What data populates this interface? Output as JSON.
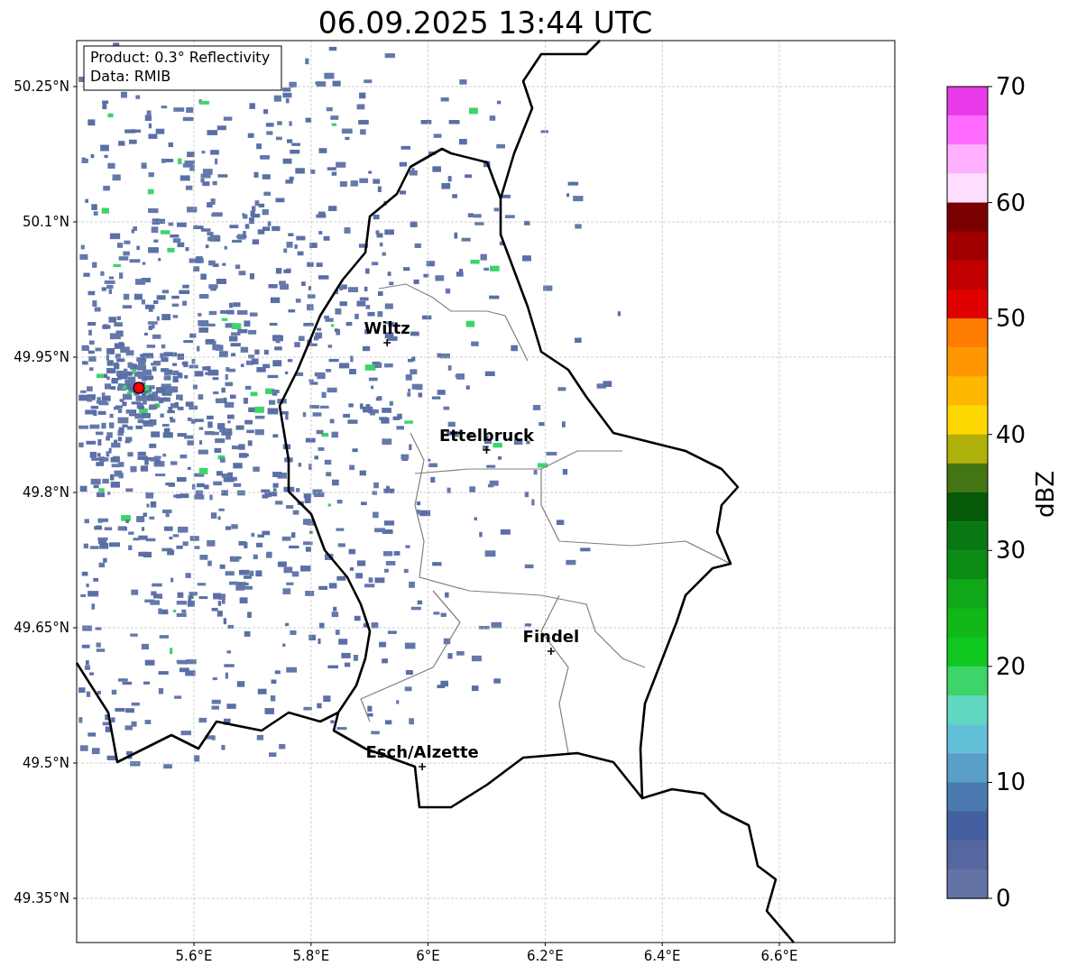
{
  "title": "06.09.2025 13:44 UTC",
  "info_box": {
    "lines": [
      "Product: 0.3° Reflectivity",
      "Data: RMIB"
    ]
  },
  "map": {
    "yticks": [
      "50.25°N",
      "50.1°N",
      "49.95°N",
      "49.8°N",
      "49.65°N",
      "49.5°N",
      "49.35°N"
    ],
    "xticks": [
      "5.6°E",
      "5.8°E",
      "6°E",
      "6.2°E",
      "6.4°E",
      "6.6°E"
    ],
    "cities": [
      {
        "name": "Wiltz"
      },
      {
        "name": "Ettelbruck"
      },
      {
        "name": "Findel"
      },
      {
        "name": "Esch/Alzette"
      }
    ]
  },
  "colorbar": {
    "label": "dBZ",
    "ticks": [
      "70",
      "60",
      "50",
      "40",
      "30",
      "20",
      "10",
      "0"
    ],
    "segments": [
      {
        "color": "#e83ae8"
      },
      {
        "color": "#ff6cff"
      },
      {
        "color": "#ffb0ff"
      },
      {
        "color": "#ffdfff"
      },
      {
        "color": "#7a0000"
      },
      {
        "color": "#a00000"
      },
      {
        "color": "#c00000"
      },
      {
        "color": "#e00000"
      },
      {
        "color": "#ff7d00"
      },
      {
        "color": "#ff9800"
      },
      {
        "color": "#ffb800"
      },
      {
        "color": "#ffd700"
      },
      {
        "color": "#b0b00a"
      },
      {
        "color": "#437514"
      },
      {
        "color": "#055a0a"
      },
      {
        "color": "#0a7812"
      },
      {
        "color": "#0b8a14"
      },
      {
        "color": "#10a818"
      },
      {
        "color": "#12b818"
      },
      {
        "color": "#10c820"
      },
      {
        "color": "#3dd46a"
      },
      {
        "color": "#60d8c0"
      },
      {
        "color": "#62c1d8"
      },
      {
        "color": "#5a9fc8"
      },
      {
        "color": "#4a7ab0"
      },
      {
        "color": "#4560a0"
      },
      {
        "color": "#5566a0"
      },
      {
        "color": "#6473a5"
      }
    ]
  }
}
